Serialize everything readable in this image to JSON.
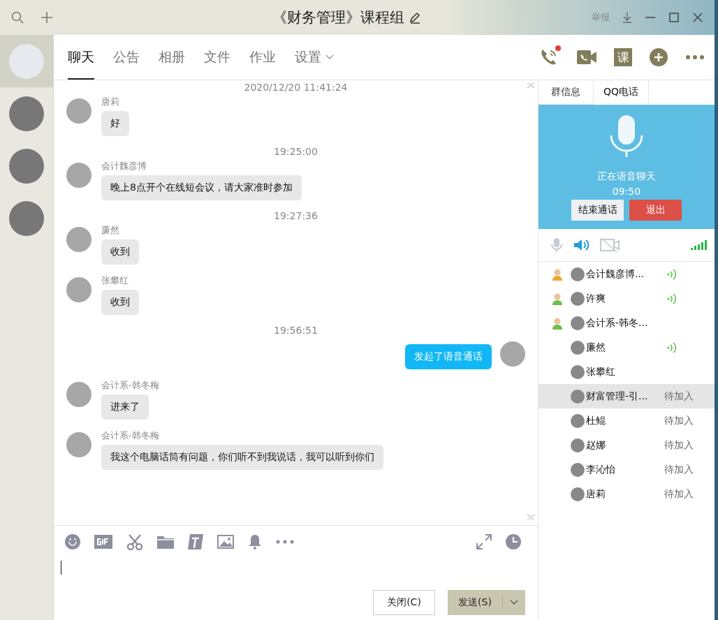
{
  "window": {
    "title": "《财务管理》课程组",
    "report": "举报"
  },
  "sidebar": {
    "items": [
      {
        "selected": true
      },
      {
        "selected": false
      },
      {
        "selected": false
      },
      {
        "selected": false
      }
    ]
  },
  "tabs": [
    {
      "label": "聊天",
      "selected": true
    },
    {
      "label": "公告",
      "selected": false
    },
    {
      "label": "相册",
      "selected": false
    },
    {
      "label": "文件",
      "selected": false
    },
    {
      "label": "作业",
      "selected": false
    },
    {
      "label": "设置",
      "selected": false,
      "dropdown": true
    }
  ],
  "toolbar": {
    "lesson": "课",
    "call_badge": true
  },
  "messages": [
    {
      "kind": "time",
      "text": "2020/12/20 11:41:24"
    },
    {
      "kind": "msg",
      "name": "唐莉",
      "text": "好",
      "self": false
    },
    {
      "kind": "time",
      "text": "19:25:00"
    },
    {
      "kind": "msg",
      "name": "会计魏彦博",
      "text": "晚上8点开个在线短会议，请大家准时参加",
      "self": false
    },
    {
      "kind": "time",
      "text": "19:27:36"
    },
    {
      "kind": "msg",
      "name": "廉然",
      "text": "收到",
      "self": false
    },
    {
      "kind": "msg",
      "name": "张攀红",
      "text": "收到",
      "self": false
    },
    {
      "kind": "time",
      "text": "19:56:51"
    },
    {
      "kind": "msg",
      "text": "发起了语音通话",
      "self": true
    },
    {
      "kind": "msg",
      "name": "会计系-韩冬梅",
      "text": "进来了",
      "self": false
    },
    {
      "kind": "msg",
      "name": "会计系-韩冬梅",
      "text": "我这个电脑话筒有问题，你们听不到我说话，我可以听到你们",
      "self": false
    }
  ],
  "input": {
    "close_button": "关闭(C)",
    "send_button": "发送(S)"
  },
  "panel": {
    "tabs": [
      {
        "label": "群信息",
        "selected": false
      },
      {
        "label": "QQ电话",
        "selected": true
      }
    ],
    "call": {
      "status": "正在语音聊天",
      "duration": "09:50",
      "end_button": "结束通话",
      "exit_button": "退出"
    },
    "media": {
      "mic_on": false,
      "speaker_on": true,
      "camera_on": false
    },
    "members": [
      {
        "name": "会计魏彦博...",
        "color": "#f0a830",
        "speaking": true,
        "selected": false
      },
      {
        "name": "许爽",
        "color": "#6cc04a",
        "speaking": true,
        "selected": false
      },
      {
        "name": "会计系-韩冬...",
        "color": "#6cc04a",
        "speaking": false,
        "selected": false
      },
      {
        "name": "廉然",
        "speaking": true,
        "selected": false
      },
      {
        "name": "张攀红",
        "speaking": false,
        "selected": false
      },
      {
        "name": "财富管理-引...",
        "status": "待加入",
        "speaking": false,
        "selected": true
      },
      {
        "name": "杜鲲",
        "status": "待加入",
        "speaking": false,
        "selected": false
      },
      {
        "name": "赵娜",
        "status": "待加入",
        "speaking": false,
        "selected": false
      },
      {
        "name": "李沁怡",
        "status": "待加入",
        "speaking": false,
        "selected": false
      },
      {
        "name": "唐莉",
        "status": "待加入",
        "speaking": false,
        "selected": false
      }
    ]
  }
}
